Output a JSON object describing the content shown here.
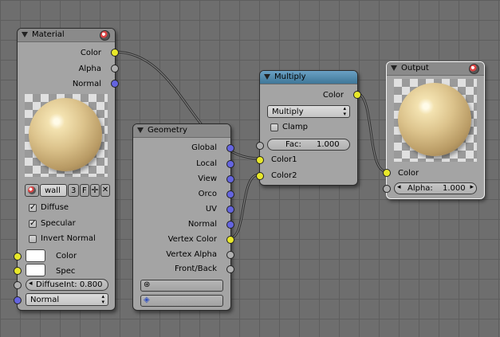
{
  "nodes": {
    "material": {
      "title": "Material",
      "outputs": [
        "Color",
        "Alpha",
        "Normal"
      ],
      "datablock": {
        "name": "wall",
        "users": "3",
        "fake": "F"
      },
      "checks": [
        {
          "label": "Diffuse",
          "checked": true
        },
        {
          "label": "Specular",
          "checked": true
        },
        {
          "label": "Invert Normal",
          "checked": false
        }
      ],
      "inputs": [
        "Color",
        "Spec"
      ],
      "diffuse_field": "DiffuseInt: 0.800",
      "normal_select": "Normal"
    },
    "geometry": {
      "title": "Geometry",
      "outputs": [
        "Global",
        "Local",
        "View",
        "Orco",
        "UV",
        "Normal",
        "Vertex Color",
        "Vertex Alpha",
        "Front/Back"
      ]
    },
    "multiply": {
      "title": "Multiply",
      "output": "Color",
      "blend_mode": "Multiply",
      "clamp_label": "Clamp",
      "clamp_checked": false,
      "fac_label": "Fac:",
      "fac_value": "1.000",
      "inputs": [
        "Color1",
        "Color2"
      ]
    },
    "output": {
      "title": "Output",
      "input": "Color",
      "alpha_label": "Alpha:",
      "alpha_value": "1.000"
    }
  },
  "colors": {
    "socket_color": "#e8e82a",
    "socket_value": "#b0b0b0",
    "socket_vector": "#6464e0",
    "header_selected": "#4a86ad",
    "grid": "#6e6e6e"
  }
}
